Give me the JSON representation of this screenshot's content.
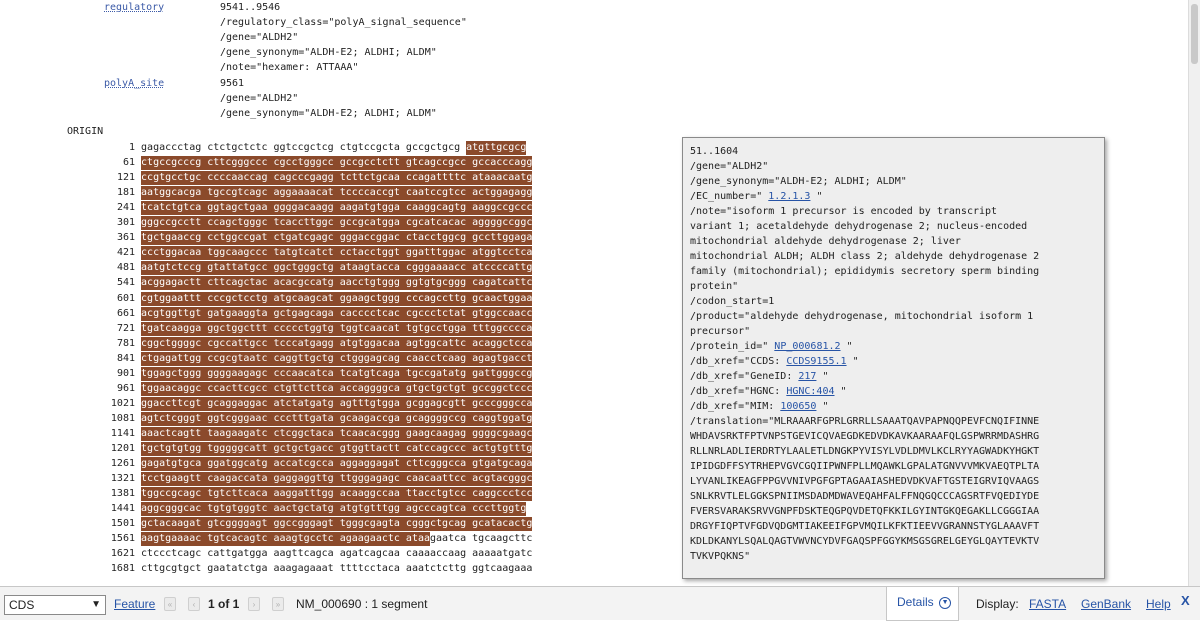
{
  "features": [
    {
      "key": "regulatory",
      "lines": [
        "9541..9546",
        "/regulatory_class=\"polyA_signal_sequence\"",
        "/gene=\"ALDH2\"",
        "/gene_synonym=\"ALDH-E2; ALDHI; ALDM\"",
        "/note=\"hexamer: ATTAAA\""
      ]
    },
    {
      "key": "polyA_site",
      "lines": [
        "9561",
        "/gene=\"ALDH2\"",
        "/gene_synonym=\"ALDH-E2; ALDHI; ALDM\""
      ]
    }
  ],
  "origin_label": "ORIGIN",
  "sequence": [
    {
      "num": "1",
      "plain": "gagaccctag ctctgctctc ggtccgctcg ctgtccgcta gccgctgcg ",
      "hl": "atgttgcgcg"
    },
    {
      "num": "61",
      "plain": "",
      "hl": "ctgccgcccg cttcgggccc cgcctgggcc gccgcctctt gtcagccgcc gccacccagg"
    },
    {
      "num": "121",
      "plain": "",
      "hl": "ccgtgcctgc ccccaaccag cagcccgagg tcttctgcaa ccagattttc ataaacaatg"
    },
    {
      "num": "181",
      "plain": "",
      "hl": "aatggcacga tgccgtcagc aggaaaacat tccccaccgt caatccgtcc actggagagg"
    },
    {
      "num": "241",
      "plain": "",
      "hl": "tcatctgtca ggtagctgaa ggggacaagg aagatgtgga caaggcagtg aaggccgccc"
    },
    {
      "num": "301",
      "plain": "",
      "hl": "gggccgcctt ccagctgggc tcaccttggc gccgcatgga cgcatcacac aggggccggc"
    },
    {
      "num": "361",
      "plain": "",
      "hl": "tgctgaaccg cctggccgat ctgatcgagc gggaccggac ctacctggcg gccttggaga"
    },
    {
      "num": "421",
      "plain": "",
      "hl": "ccctggacaa tggcaagccc tatgtcatct cctacctggt ggatttggac atggtcctca"
    },
    {
      "num": "481",
      "plain": "",
      "hl": "aatgtctccg gtattatgcc ggctgggctg ataagtacca cgggaaaacc atccccattg"
    },
    {
      "num": "541",
      "plain": "",
      "hl": "acggagactt cttcagctac acacgccatg aacctgtggg ggtgtgcggg cagatcattc"
    },
    {
      "num": "601",
      "plain": "",
      "hl": "cgtggaattt cccgctcctg atgcaagcat ggaagctggg cccagccttg gcaactggaa"
    },
    {
      "num": "661",
      "plain": "",
      "hl": "acgtggttgt gatgaaggta gctgagcaga cacccctcac cgccctctat gtggccaacc"
    },
    {
      "num": "721",
      "plain": "",
      "hl": "tgatcaagga ggctggcttt ccccctggtg tggtcaacat tgtgcctgga tttggcccca"
    },
    {
      "num": "781",
      "plain": "",
      "hl": "cggctggggc cgccattgcc tcccatgagg atgtggacaa agtggcattc acaggctcca"
    },
    {
      "num": "841",
      "plain": "",
      "hl": "ctgagattgg ccgcgtaatc caggttgctg ctgggagcag caacctcaag agagtgacct"
    },
    {
      "num": "901",
      "plain": "",
      "hl": "tggagctggg ggggaagagc cccaacatca tcatgtcaga tgccgatatg gattgggccg"
    },
    {
      "num": "961",
      "plain": "",
      "hl": "tggaacaggc ccacttcgcc ctgttcttca accaggggca gtgctgctgt gccggctccc"
    },
    {
      "num": "1021",
      "plain": "",
      "hl": "ggaccttcgt gcaggaggac atctatgatg agtttgtgga gcggagcgtt gcccgggcca"
    },
    {
      "num": "1081",
      "plain": "",
      "hl": "agtctcgggt ggtcgggaac ccctttgata gcaagaccga gcaggggccg caggtggatg"
    },
    {
      "num": "1141",
      "plain": "",
      "hl": "aaactcagtt taagaagatc ctcggctaca tcaacacggg gaagcaagag ggggcgaagc"
    },
    {
      "num": "1201",
      "plain": "",
      "hl": "tgctgtgtgg tgggggcatt gctgctgacc gtggttactt catccagccc actgtgtttg"
    },
    {
      "num": "1261",
      "plain": "",
      "hl": "gagatgtgca ggatggcatg accatcgcca aggaggagat cttcgggcca gtgatgcaga"
    },
    {
      "num": "1321",
      "plain": "",
      "hl": "tcctgaagtt caagaccata gaggaggttg ttgggagagc caacaattcc acgtacgggc"
    },
    {
      "num": "1381",
      "plain": "",
      "hl": "tggccgcagc tgtcttcaca aaggatttgg acaaggccaa ttacctgtcc caggccctcc"
    },
    {
      "num": "1441",
      "plain": "",
      "hl": "aggcgggcac tgtgtgggtc aactgctatg atgtgtttgg agcccagtca cccttggtg"
    },
    {
      "num": "1501",
      "plain": "",
      "hl": "gctacaagat gtcggggagt ggccgggagt tgggcgagta cgggctgcag gcatacactg"
    },
    {
      "num": "1561",
      "plain": "",
      "hl": "aagtgaaaac tgtcacagtc aaagtgcctc agaagaactc ataa",
      "tail": "gaatca tgcaagcttc"
    },
    {
      "num": "1621",
      "plain": "ctccctcagc cattgatgga aagttcagca agatcagcaa caaaaccaag aaaaatgatc",
      "hl": ""
    },
    {
      "num": "1681",
      "plain": "cttgcgtgct gaatatctga aaagagaaat ttttcctaca aaatctcttg ggtcaagaaa",
      "hl": ""
    }
  ],
  "popup": {
    "lines": [
      [
        "51..1604"
      ],
      [
        "/gene=\"ALDH2\""
      ],
      [
        "/gene_synonym=\"ALDH-E2; ALDHI; ALDM\""
      ],
      [
        "/EC_number=\" ",
        "1.2.1.3",
        " \""
      ],
      [
        "/note=\"isoform 1 precursor is encoded by transcript"
      ],
      [
        "variant 1; acetaldehyde dehydrogenase 2; nucleus-encoded"
      ],
      [
        "mitochondrial aldehyde dehydrogenase 2; liver"
      ],
      [
        "mitochondrial ALDH; ALDH class 2; aldehyde dehydrogenase 2"
      ],
      [
        "family (mitochondrial); epididymis secretory sperm binding"
      ],
      [
        "protein\""
      ],
      [
        "/codon_start=1"
      ],
      [
        "/product=\"aldehyde dehydrogenase, mitochondrial isoform 1"
      ],
      [
        "precursor\""
      ],
      [
        "/protein_id=\" ",
        "NP_000681.2",
        " \""
      ],
      [
        "/db_xref=\"CCDS: ",
        "CCDS9155.1",
        " \""
      ],
      [
        "/db_xref=\"GeneID: ",
        "217",
        " \""
      ],
      [
        "/db_xref=\"HGNC: ",
        "HGNC:404",
        " \""
      ],
      [
        "/db_xref=\"MIM: ",
        "100650",
        " \""
      ],
      [
        "/translation=\"MLRAAARFGPRLGRRLLSAAATQAVPAPNQQPEVFCNQIFINNE"
      ],
      [
        "WHDAVSRKTFPTVNPSTGEVICQVAEGDKEDVDKAVKAARAAFQLGSPWRRMDASHRG"
      ],
      [
        "RLLNRLADLIERDRTYLAALETLDNGKPYVISYLVDLDMVLKCLRYYAGWADKYHGKT"
      ],
      [
        "IPIDGDFFSYTRHEPVGVCGQIIPWNFPLLMQAWKLGPALATGNVVVMKVAEQTPLTA"
      ],
      [
        "LYVANLIKEAGFPPGVVNIVPGFGPTAGAAIASHEDVDKVAFTGSTEIGRVIQVAAGS"
      ],
      [
        "SNLKRVTLELGGKSPNIIMSDADMDWAVEQAHFALFFNQGQCCCAGSRTFVQEDIYDE"
      ],
      [
        "FVERSVARAKSRVVGNPFDSKTEQGPQVDETQFKKILGYINTGKQEGAKLLCGGGIAA"
      ],
      [
        "DRGYFIQPTVFGDVQDGMTIAKEEIFGPVMQILKFKTIEEVVGRANNSTYGLAAAVFT"
      ],
      [
        "KDLDKANYLSQALQAGTVWVNCYDVFGAQSPFGGYKMSGSGRELGEYGLQAYTEVKTV"
      ],
      [
        "TVKVPQKNS\""
      ]
    ]
  },
  "bottombar": {
    "select_value": "CDS",
    "feature_label": "Feature",
    "pager": "1 of 1",
    "record": "NM_000690 : 1 segment",
    "details_label": "Details",
    "display_label": "Display:",
    "fasta": "FASTA",
    "genbank": "GenBank",
    "help": "Help",
    "close": "X"
  }
}
